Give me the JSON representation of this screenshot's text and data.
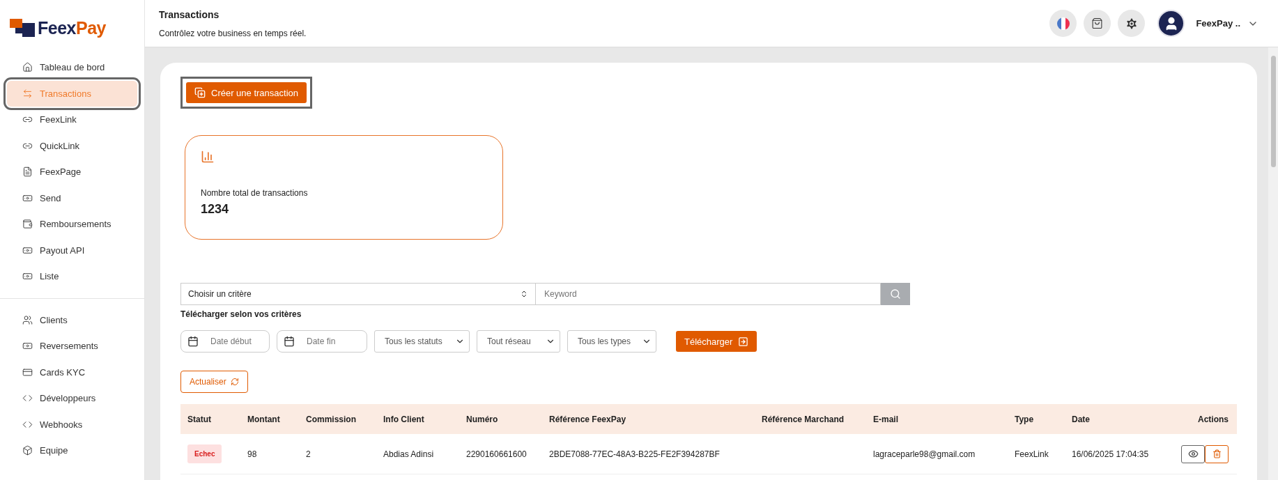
{
  "logo": {
    "part_1": "Feex",
    "part_2": "Pay"
  },
  "sidebar": {
    "groups": [
      [
        {
          "label": "Tableau de bord",
          "kind": "home",
          "selected": false
        },
        {
          "label": "Transactions",
          "kind": "transfer",
          "selected": true
        },
        {
          "label": "FeexLink",
          "kind": "link",
          "selected": false
        },
        {
          "label": "QuickLink",
          "kind": "link",
          "selected": false
        },
        {
          "label": "FeexPage",
          "kind": "page",
          "selected": false
        },
        {
          "label": "Send",
          "kind": "money",
          "selected": false
        },
        {
          "label": "Remboursements",
          "kind": "wallet",
          "selected": false
        },
        {
          "label": "Payout API",
          "kind": "money",
          "selected": false
        },
        {
          "label": "Liste",
          "kind": "money",
          "selected": false
        }
      ],
      [
        {
          "label": "Clients",
          "kind": "users",
          "selected": false
        },
        {
          "label": "Reversements",
          "kind": "money",
          "selected": false
        },
        {
          "label": "Cards KYC",
          "kind": "card",
          "selected": false
        },
        {
          "label": "Développeurs",
          "kind": "code",
          "selected": false
        },
        {
          "label": "Webhooks",
          "kind": "code",
          "selected": false
        },
        {
          "label": "Equipe",
          "kind": "box",
          "selected": false
        }
      ]
    ]
  },
  "header": {
    "title": "Transactions",
    "subtitle": "Contrôlez votre business en temps réel.",
    "user_name": "FeexPay .."
  },
  "create_button": "Créer une transaction",
  "stat_card": {
    "label": "Nombre total de transactions",
    "value": "1234"
  },
  "search": {
    "criteria_value": "Choisir un critère",
    "placeholder": "Keyword"
  },
  "download": {
    "heading": "Télécharger selon vos critères",
    "date_fields": [
      {
        "placeholder": "Date début"
      },
      {
        "placeholder": "Date fin"
      }
    ],
    "selects": [
      {
        "value": "Tous les statuts"
      },
      {
        "value": "Tout réseau"
      },
      {
        "value": "Tous les types"
      }
    ],
    "button": "Télécharger"
  },
  "refresh_button": "Actualiser",
  "table": {
    "columns": [
      "Statut",
      "Montant",
      "Commission",
      "Info Client",
      "Numéro",
      "Référence FeexPay",
      "Référence Marchand",
      "E-mail",
      "Type",
      "Date",
      "Actions"
    ],
    "rows": [
      {
        "status": {
          "label": "Echec",
          "kind": "error"
        },
        "amount": "98",
        "commission": "2",
        "client": "Abdias Adinsi",
        "number": "2290160661600",
        "ref_feexpay": "2BDE7088-77EC-48A3-B225-FE2F394287BF",
        "email": "lagraceparle98@gmail.com",
        "type": "FeexLink",
        "date": "16/06/2025 17:04:35"
      }
    ]
  }
}
